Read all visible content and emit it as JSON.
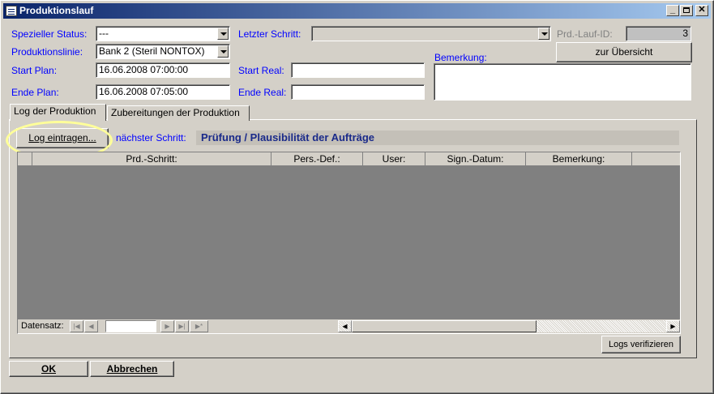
{
  "window": {
    "title": "Produktionslauf"
  },
  "form": {
    "status_label": "Spezieller Status:",
    "status_value": "---",
    "line_label": "Produktionslinie:",
    "line_value": "Bank 2 (Steril NONTOX)",
    "start_plan_label": "Start Plan:",
    "start_plan_value": "16.06.2008 07:00:00",
    "end_plan_label": "Ende Plan:",
    "end_plan_value": "16.06.2008 07:05:00",
    "last_step_label": "Letzter Schritt:",
    "last_step_value": "",
    "start_real_label": "Start Real:",
    "start_real_value": "",
    "end_real_label": "Ende Real:",
    "end_real_value": "",
    "run_id_label": "Prd.-Lauf-ID:",
    "run_id_value": "3",
    "overview_button": "zur Übersicht",
    "remark_label": "Bemerkung:",
    "remark_value": ""
  },
  "tabs": [
    {
      "label": "Log der Produktion",
      "active": true
    },
    {
      "label": "Zubereitungen der Produktion",
      "active": false
    }
  ],
  "log": {
    "log_button": "Log eintragen...",
    "next_step_label": "nächster Schritt:",
    "next_step_value": "Prüfung / Plausibilität der Aufträge",
    "columns": [
      "Prd.-Schritt:",
      "Pers.-Def.:",
      "User:",
      "Sign.-Datum:",
      "Bemerkung:"
    ],
    "record_label": "Datensatz:",
    "record_value": "",
    "verify_button": "Logs verifizieren"
  },
  "footer": {
    "ok_button": "OK",
    "cancel_button": "Abbrechen"
  },
  "colors": {
    "label_blue": "#0000ff",
    "title_dark": "#0a246a",
    "next_step": "#1a2a8a",
    "grid_bg": "#808080",
    "highlight": "#ffff99"
  }
}
